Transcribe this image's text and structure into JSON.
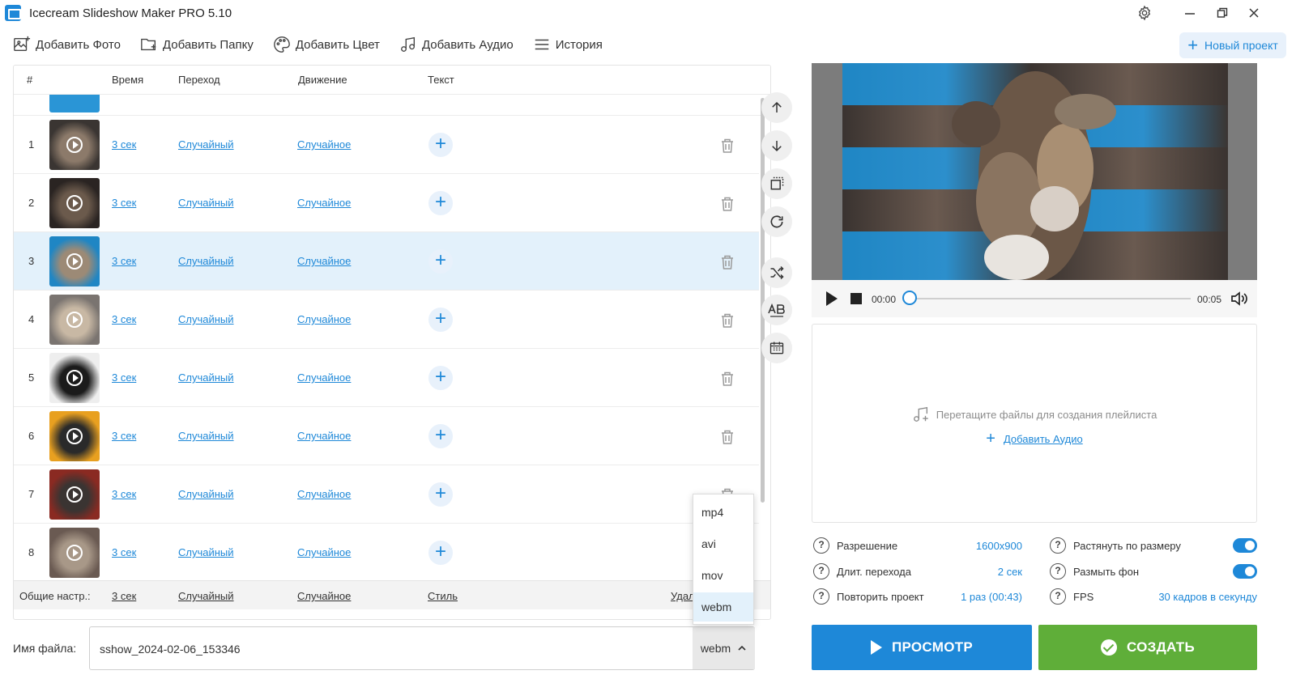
{
  "window": {
    "title": "Icecream Slideshow Maker PRO 5.10"
  },
  "toolbar": {
    "add_photo": "Добавить Фото",
    "add_folder": "Добавить Папку",
    "add_color": "Добавить Цвет",
    "add_audio": "Добавить Аудио",
    "history": "История",
    "new_project": "Новый проект"
  },
  "table": {
    "headers": {
      "num": "#",
      "time": "Время",
      "transition": "Переход",
      "motion": "Движение",
      "text": "Текст"
    },
    "rows": [
      {
        "num": "1",
        "time": "3 сек",
        "transition": "Случайный",
        "motion": "Случайное",
        "selected": false
      },
      {
        "num": "2",
        "time": "3 сек",
        "transition": "Случайный",
        "motion": "Случайное",
        "selected": false
      },
      {
        "num": "3",
        "time": "3 сек",
        "transition": "Случайный",
        "motion": "Случайное",
        "selected": true
      },
      {
        "num": "4",
        "time": "3 сек",
        "transition": "Случайный",
        "motion": "Случайное",
        "selected": false
      },
      {
        "num": "5",
        "time": "3 сек",
        "transition": "Случайный",
        "motion": "Случайное",
        "selected": false
      },
      {
        "num": "6",
        "time": "3 сек",
        "transition": "Случайный",
        "motion": "Случайное",
        "selected": false
      },
      {
        "num": "7",
        "time": "3 сек",
        "transition": "Случайный",
        "motion": "Случайное",
        "selected": false
      },
      {
        "num": "8",
        "time": "3 сек",
        "transition": "Случайный",
        "motion": "Случайное",
        "selected": false
      }
    ],
    "footer": {
      "label": "Общие настр.:",
      "time": "3 сек",
      "transition": "Случайный",
      "motion": "Случайное",
      "style": "Стиль",
      "delete": "Удал"
    }
  },
  "format_dropdown": {
    "options": [
      "mp4",
      "avi",
      "mov",
      "webm"
    ],
    "selected": "webm"
  },
  "filename": {
    "label": "Имя файла:",
    "value": "sshow_2024-02-06_153346",
    "format": "webm"
  },
  "player": {
    "time_start": "00:00",
    "time_end": "00:05",
    "progress": 0
  },
  "audio": {
    "hint": "Перетащите файлы для создания плейлиста",
    "add_link": "Добавить Аудио"
  },
  "settings": {
    "resolution": {
      "label": "Разрешение",
      "value": "1600x900"
    },
    "transition_length": {
      "label": "Длит. перехода",
      "value": "2 сек"
    },
    "repeat": {
      "label": "Повторить проект",
      "value": "1 раз (00:43)"
    },
    "stretch": {
      "label": "Растянуть по размеру",
      "on": true
    },
    "blur_bg": {
      "label": "Размыть фон",
      "on": true
    },
    "fps": {
      "label": "FPS",
      "value": "30 кадров в секунду"
    }
  },
  "buttons": {
    "preview": "ПРОСМОТР",
    "create": "СОЗДАТЬ"
  },
  "colors": {
    "accent": "#1e88d8",
    "create_green": "#5fae39",
    "selected_row": "#e3f1fb"
  }
}
